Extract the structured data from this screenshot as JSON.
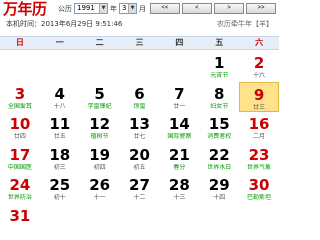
{
  "header": {
    "app_title": "万年历",
    "gregorian_label": "公历",
    "year_value": "1991",
    "year_unit": "年",
    "month_value": "3",
    "month_unit": "月",
    "nav_buttons": [
      "<<",
      "<",
      ">",
      ">>"
    ],
    "local_time_label": "本机时间：",
    "local_time_value": "2013年6月29日 9:51:46",
    "lunar_link": "农历牵牛年【羊】"
  },
  "weekdays": [
    "日",
    "一",
    "二",
    "三",
    "四",
    "五",
    "六"
  ],
  "colors": {
    "accent_red": "#cc0000",
    "holiday_green": "#009900",
    "header_bg": "#e6eef8",
    "today_bg": "#ffe28a"
  },
  "calendar": {
    "weeks": [
      [
        {
          "num": "",
          "sub": ""
        },
        {
          "num": "",
          "sub": ""
        },
        {
          "num": "",
          "sub": ""
        },
        {
          "num": "",
          "sub": ""
        },
        {
          "num": "",
          "sub": ""
        },
        {
          "num": "1",
          "sub": "元宵节",
          "green": true
        },
        {
          "num": "2",
          "sub": "十六",
          "red": true
        }
      ],
      [
        {
          "num": "3",
          "sub": "全国爱耳",
          "green": true,
          "red": true
        },
        {
          "num": "4",
          "sub": "十八"
        },
        {
          "num": "5",
          "sub": "学雷锋纪",
          "green": true
        },
        {
          "num": "6",
          "sub": "惊蛰",
          "green": true
        },
        {
          "num": "7",
          "sub": "廿一"
        },
        {
          "num": "8",
          "sub": "妇女节",
          "green": true
        },
        {
          "num": "9",
          "sub": "廿三",
          "red": true,
          "today": true
        }
      ],
      [
        {
          "num": "10",
          "sub": "廿四",
          "red": true
        },
        {
          "num": "11",
          "sub": "廿五"
        },
        {
          "num": "12",
          "sub": "植树节",
          "green": true
        },
        {
          "num": "13",
          "sub": "廿七"
        },
        {
          "num": "14",
          "sub": "国际警察",
          "green": true
        },
        {
          "num": "15",
          "sub": "消费者权",
          "green": true
        },
        {
          "num": "16",
          "sub": "二月",
          "red": true
        }
      ],
      [
        {
          "num": "17",
          "sub": "中国国医",
          "green": true,
          "red": true
        },
        {
          "num": "18",
          "sub": "初三"
        },
        {
          "num": "19",
          "sub": "初四"
        },
        {
          "num": "20",
          "sub": "初五"
        },
        {
          "num": "21",
          "sub": "春分",
          "green": true
        },
        {
          "num": "22",
          "sub": "世界水日",
          "green": true
        },
        {
          "num": "23",
          "sub": "世界气象",
          "green": true,
          "red": true
        }
      ],
      [
        {
          "num": "24",
          "sub": "世界防治",
          "green": true,
          "red": true
        },
        {
          "num": "25",
          "sub": "初十"
        },
        {
          "num": "26",
          "sub": "十一"
        },
        {
          "num": "27",
          "sub": "十二"
        },
        {
          "num": "28",
          "sub": "十三"
        },
        {
          "num": "29",
          "sub": "十四"
        },
        {
          "num": "30",
          "sub": "巴勒斯坦",
          "green": true,
          "red": true
        }
      ],
      [
        {
          "num": "31",
          "sub": "",
          "red": true
        },
        {
          "num": "",
          "sub": ""
        },
        {
          "num": "",
          "sub": ""
        },
        {
          "num": "",
          "sub": ""
        },
        {
          "num": "",
          "sub": ""
        },
        {
          "num": "",
          "sub": ""
        },
        {
          "num": "",
          "sub": ""
        }
      ]
    ]
  }
}
